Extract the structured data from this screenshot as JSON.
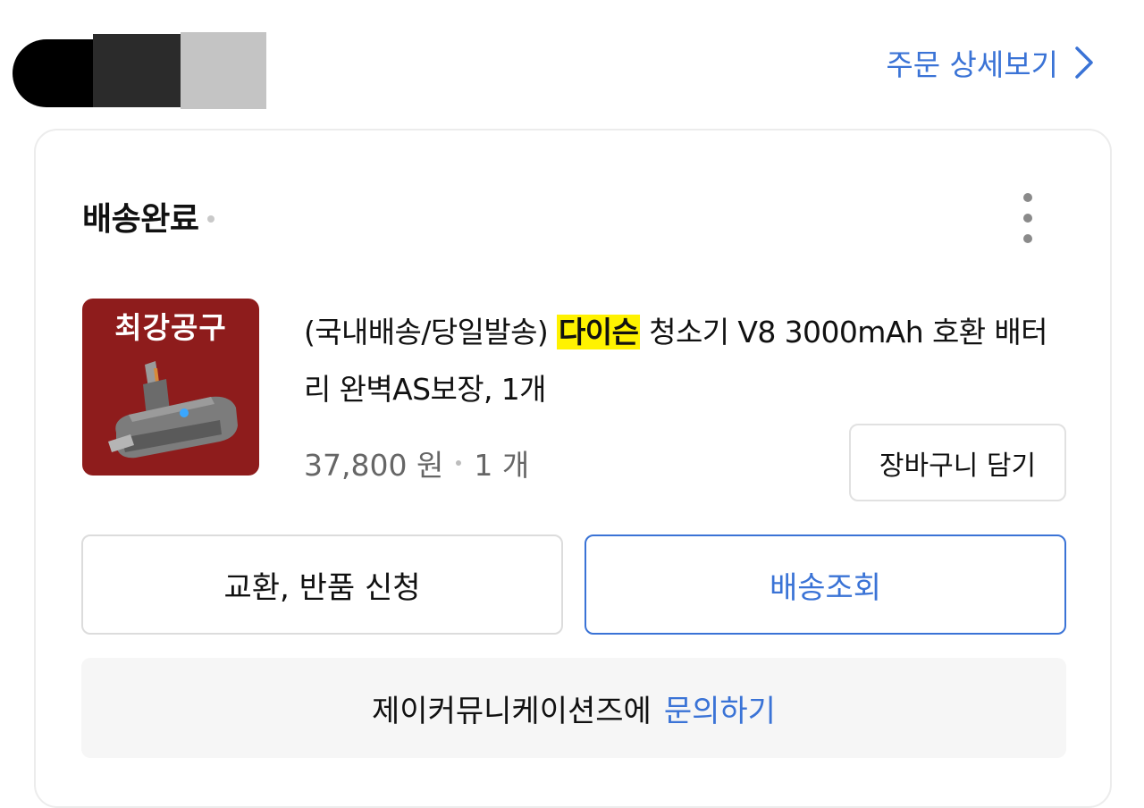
{
  "header": {
    "order_detail_label": "주문 상세보기",
    "chevron_icon": "chevron-right-icon"
  },
  "card": {
    "status": "배송완료",
    "more_icon": "more-vertical-icon"
  },
  "product": {
    "thumbnail_label": "최강공구",
    "title_prefix": "(국내배송/당일발송)",
    "title_highlight": "다이슨",
    "title_rest": "청소기 V8 3000mAh 호환 배터리 완벽AS보장, 1개",
    "price": "37,800 원",
    "quantity": "1 개",
    "cart_button": "장바구니 담기"
  },
  "actions": {
    "exchange_return": "교환, 반품 신청",
    "track_delivery": "배송조회"
  },
  "inquiry": {
    "seller": "제이커뮤니케이션즈에",
    "link": "문의하기"
  },
  "colors": {
    "accent": "#3a73d6",
    "highlight": "#fff200",
    "thumbnail_bg": "#8e1c1c"
  }
}
